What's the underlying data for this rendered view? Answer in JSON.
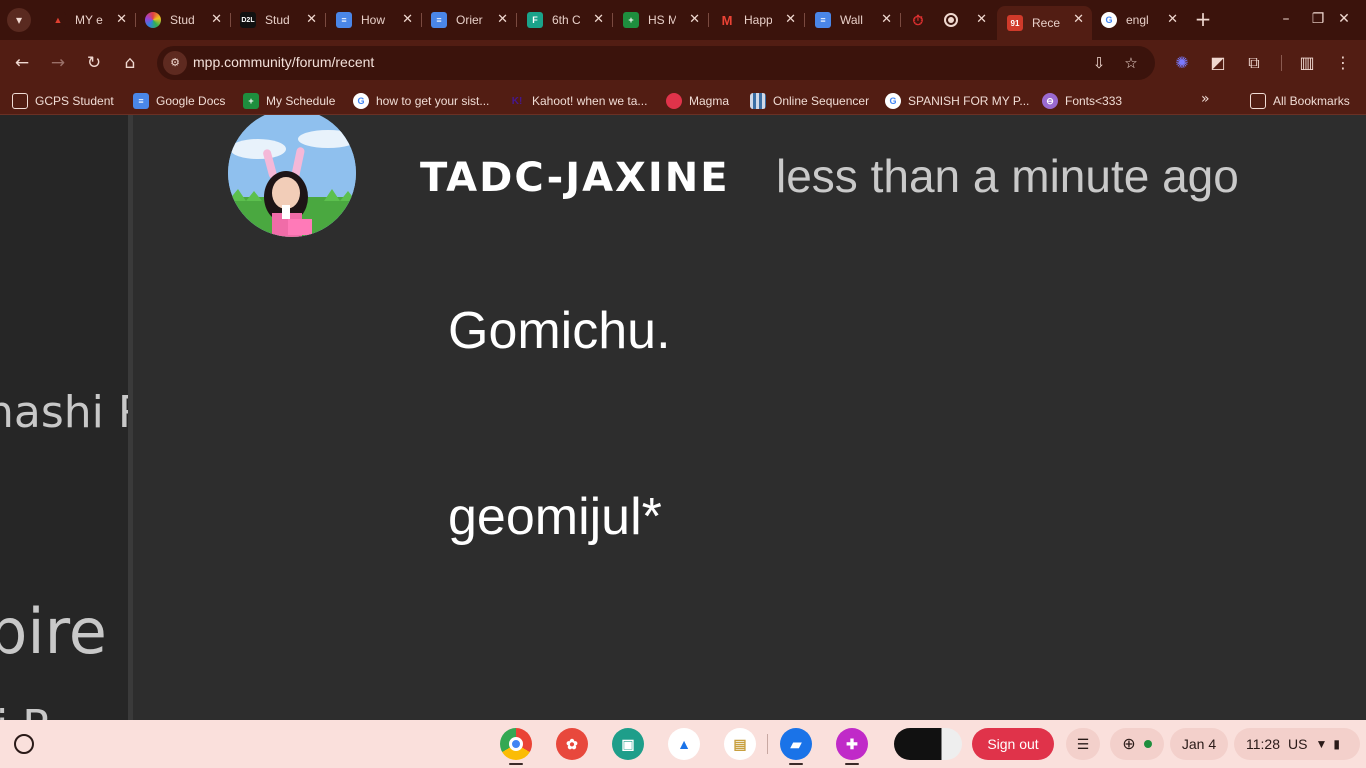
{
  "browser": {
    "tabs": [
      {
        "title": "MY e",
        "favicon_color": "#3b130c",
        "favicon_text": "▲",
        "icon": "game-icon"
      },
      {
        "title": "Stud",
        "favicon_color": "#8a3fd0",
        "favicon_text": "●",
        "icon": "app-icon"
      },
      {
        "title": "Stud",
        "favicon_color": "#111111",
        "favicon_text": "D2L",
        "icon": "d2l-icon"
      },
      {
        "title": "How",
        "favicon_color": "#4a86e8",
        "favicon_text": "≡",
        "icon": "docs-icon"
      },
      {
        "title": "Orier",
        "favicon_color": "#4a86e8",
        "favicon_text": "≡",
        "icon": "docs-icon"
      },
      {
        "title": "6th C",
        "favicon_color": "#1aa38a",
        "favicon_text": "F",
        "icon": "forms-icon"
      },
      {
        "title": "HS M",
        "favicon_color": "#1e8e3e",
        "favicon_text": "+",
        "icon": "sheets-icon"
      },
      {
        "title": "Happ",
        "favicon_color": "#ea4335",
        "favicon_text": "M",
        "icon": "gmail-icon"
      },
      {
        "title": "Wall",
        "favicon_color": "#4a86e8",
        "favicon_text": "≡",
        "icon": "docs-icon"
      },
      {
        "title": "",
        "favicon_color": "#e03030",
        "favicon_text": "⏱",
        "icon": "timer-icon"
      },
      {
        "title": "Rece",
        "favicon_color": "#d03a2a",
        "favicon_text": "91",
        "icon": "mpp-icon"
      },
      {
        "title": "engl",
        "favicon_color": "#ffffff",
        "favicon_text": "G",
        "icon": "google-icon"
      }
    ],
    "address_bar": {
      "url": "mpp.community/forum/recent"
    },
    "bookmarks": [
      {
        "label": "GCPS Student",
        "icon": "folder-icon",
        "color": "#521d13"
      },
      {
        "label": "Google Docs",
        "icon": "docs-icon",
        "color": "#4a86e8"
      },
      {
        "label": "My Schedule",
        "icon": "sheets-icon",
        "color": "#1e8e3e"
      },
      {
        "label": "how to get your sist...",
        "icon": "google-icon",
        "color": "#ffffff"
      },
      {
        "label": "Kahoot! when we ta...",
        "icon": "kahoot-icon",
        "color": "#46178f"
      },
      {
        "label": "Magma",
        "icon": "magma-icon",
        "color": "#e0334a"
      },
      {
        "label": "Online Sequencer",
        "icon": "sequencer-icon",
        "color": "#3a6ea5"
      },
      {
        "label": "SPANISH FOR MY P...",
        "icon": "google-icon",
        "color": "#ffffff"
      },
      {
        "label": "Fonts<333",
        "icon": "fonts-icon",
        "color": "#9a6ad0"
      }
    ],
    "all_bookmarks_label": "All Bookmarks"
  },
  "page": {
    "sidebar_clips": [
      "nashi R",
      "pire",
      "i R"
    ],
    "post": {
      "username": "TADC-JAXINE",
      "timestamp": "less than a minute ago",
      "lines": [
        "Gomichu.",
        "geomijul*"
      ]
    }
  },
  "shelf": {
    "apps": [
      {
        "name": "chrome",
        "color": "#ffffff"
      },
      {
        "name": "canvas",
        "color": "#e8483c"
      },
      {
        "name": "classroom",
        "color": "#1e9e8a"
      },
      {
        "name": "drive",
        "color": "#ffffff"
      },
      {
        "name": "keep",
        "color": "#ffffff"
      },
      {
        "name": "files",
        "color": "#1a73e8"
      },
      {
        "name": "gallery",
        "color": "#c02ac8"
      }
    ],
    "sign_out_label": "Sign out",
    "date": "Jan 4",
    "time": "11:28",
    "locale": "US"
  }
}
